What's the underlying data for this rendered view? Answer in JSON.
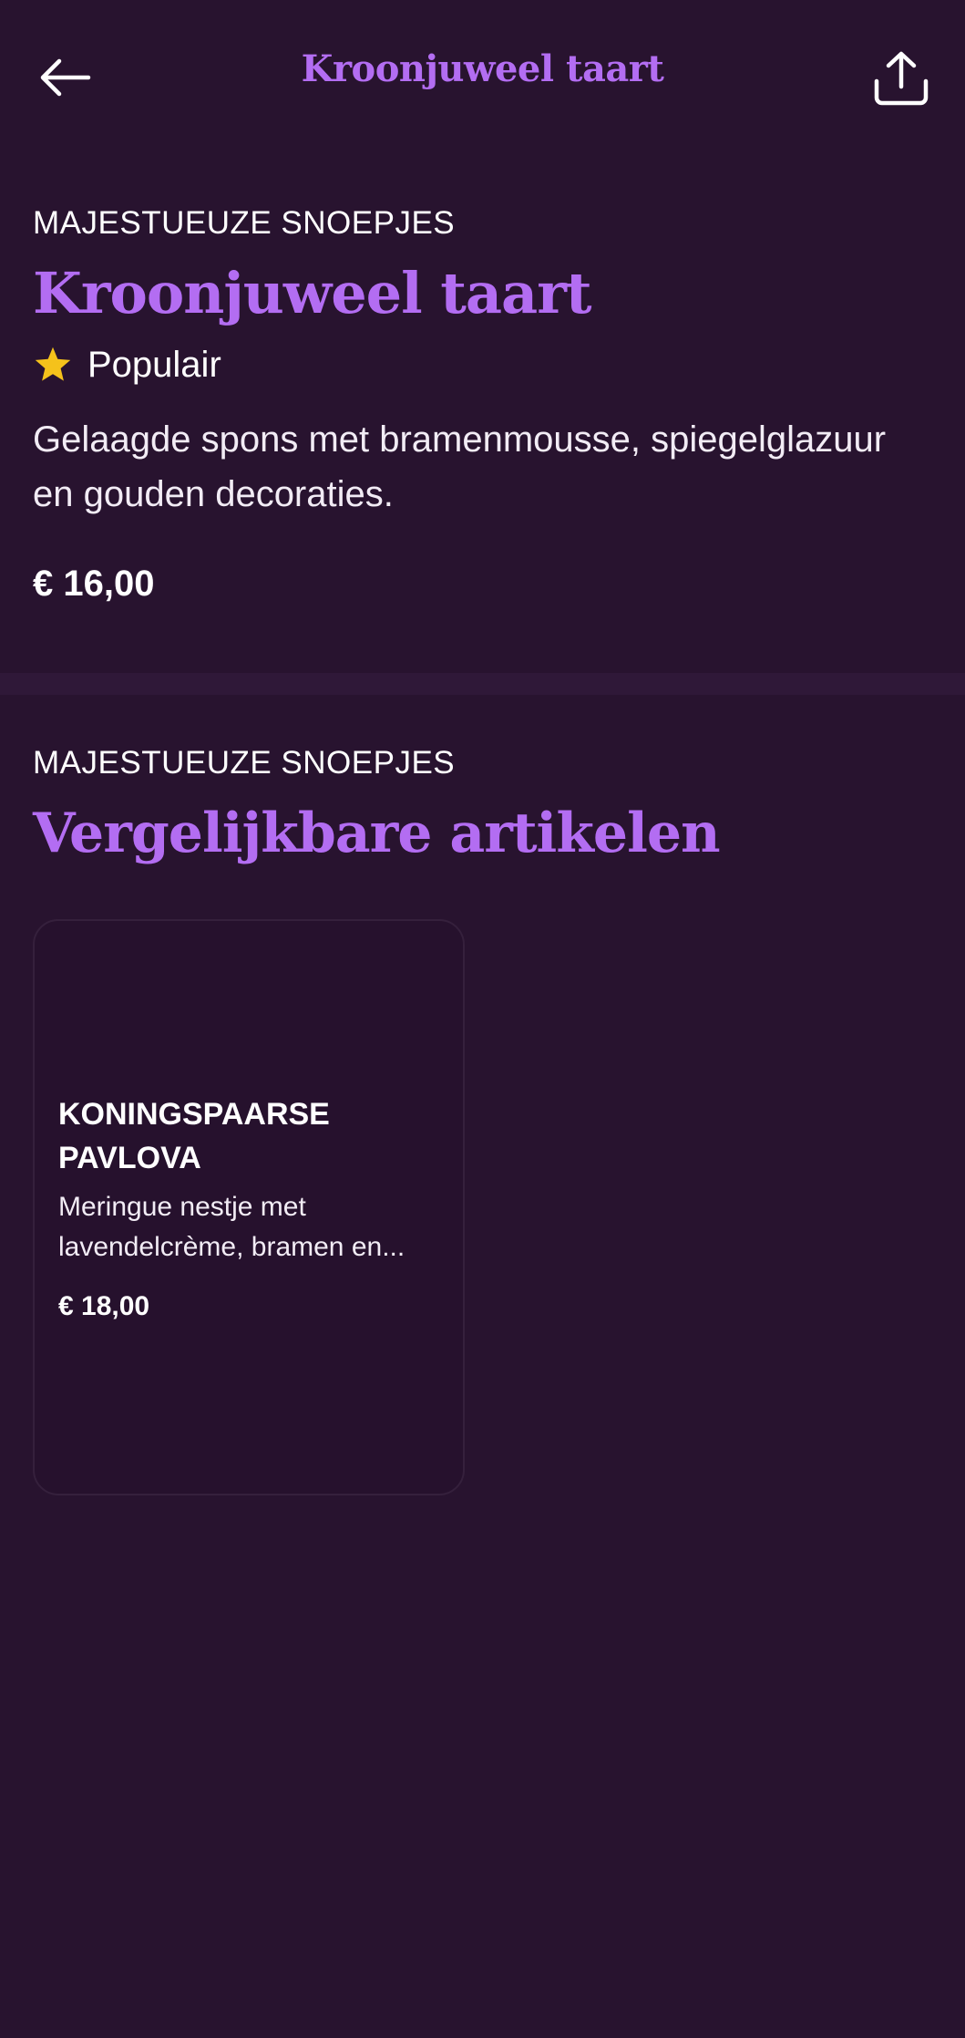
{
  "header": {
    "title": "Kroonjuweel taart",
    "back_icon": "arrow-left-icon",
    "share_icon": "share-icon"
  },
  "product": {
    "category": "MAJESTUEUZE SNOEPJES",
    "name": "Kroonjuweel taart",
    "badge": "Populair",
    "badge_icon": "star-icon",
    "description": "Gelaagde spons met bramenmousse, spiegelglazuur en gouden decoraties.",
    "price": "€ 16,00"
  },
  "similar": {
    "category": "MAJESTUEUZE SNOEPJES",
    "title": "Vergelijkbare artikelen",
    "items": [
      {
        "name": "KONINGSPAARSE PAVLOVA",
        "description": "Meringue nestje met lavendelcrème, bramen en...",
        "price": "€ 18,00"
      }
    ]
  },
  "colors": {
    "background": "#28132f",
    "accent": "#b36df2",
    "star": "#f5c21b",
    "text": "#ffffff"
  }
}
